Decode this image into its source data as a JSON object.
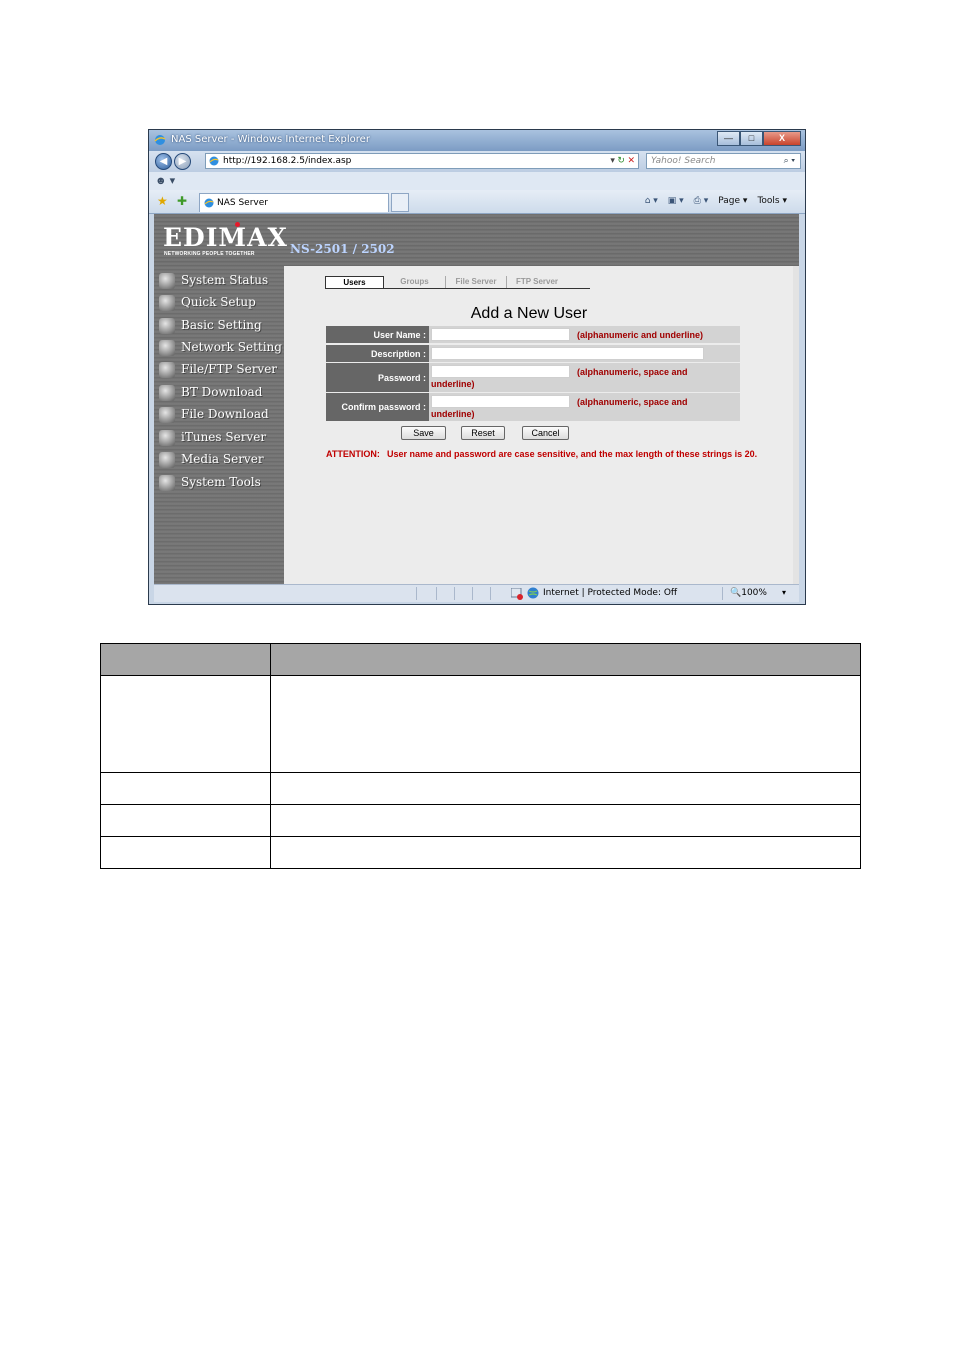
{
  "window": {
    "title": "NAS Server - Windows Internet Explorer",
    "buttons": {
      "minimize": "—",
      "maximize": "□",
      "close": "X"
    }
  },
  "address_bar": {
    "url": "http://192.168.2.5/index.asp",
    "search_placeholder": "Yahoo! Search"
  },
  "tab": {
    "label": "NAS Server"
  },
  "command_bar": {
    "page": "Page ▾",
    "tools": "Tools ▾"
  },
  "brand": {
    "logo": "EDIMAX",
    "tagline": "NETWORKING PEOPLE TOGETHER",
    "model": "NS-2501 / 2502"
  },
  "sidebar": {
    "items": [
      {
        "label": "System Status",
        "icon": "system-status-icon"
      },
      {
        "label": "Quick Setup",
        "icon": "quick-setup-icon"
      },
      {
        "label": "Basic Setting",
        "icon": "basic-setting-icon"
      },
      {
        "label": "Network Setting",
        "icon": "network-setting-icon"
      },
      {
        "label": "File/FTP Server",
        "icon": "file-ftp-server-icon"
      },
      {
        "label": "BT Download",
        "icon": "bt-download-icon"
      },
      {
        "label": "File Download",
        "icon": "file-download-icon"
      },
      {
        "label": "iTunes Server",
        "icon": "itunes-server-icon"
      },
      {
        "label": "Media Server",
        "icon": "media-server-icon"
      },
      {
        "label": "System Tools",
        "icon": "system-tools-icon"
      }
    ]
  },
  "subtabs": [
    "Users",
    "Groups",
    "File Server",
    "FTP Server"
  ],
  "form": {
    "title": "Add a New User",
    "user_name": {
      "label": "User Name  :",
      "value": "",
      "hint": "(alphanumeric and underline)"
    },
    "description": {
      "label": "Description  :",
      "value": ""
    },
    "password": {
      "label": "Password  :",
      "value": "",
      "hint_a": "(alphanumeric, space and",
      "hint_b": "underline)"
    },
    "confirm_password": {
      "label": "Confirm password  :",
      "value": "",
      "hint_a": "(alphanumeric, space and",
      "hint_b": "underline)"
    },
    "buttons": {
      "save": "Save",
      "reset": "Reset",
      "cancel": "Cancel"
    },
    "attention_label": "ATTENTION:",
    "attention_text": "User name and password are case sensitive, and the max length of these strings is 20."
  },
  "status_bar": {
    "zone": "Internet | Protected Mode: Off",
    "zoom": "100%"
  },
  "colors": {
    "hint_red": "#a00000",
    "attention_red": "#c00000",
    "banner_gray": "#707070",
    "label_gray": "#666666",
    "table_header": "#a6a6a6"
  }
}
